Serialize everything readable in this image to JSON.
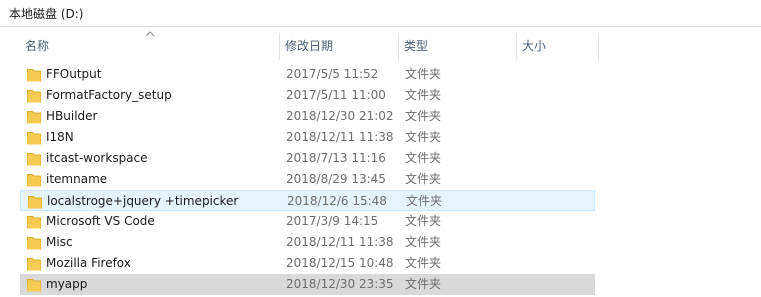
{
  "breadcrumb": "本地磁盘 (D:)",
  "columns": {
    "name": "名称",
    "date": "修改日期",
    "type": "类型",
    "size": "大小"
  },
  "colors": {
    "folder": "#f5cb51",
    "folder_dark": "#dcaa2c",
    "header_text": "#4c607a",
    "hover_bg": "#e5f3ff",
    "selected_bg": "#d9d9d9"
  },
  "rows": [
    {
      "name": "FFOutput",
      "date": "2017/5/5 11:52",
      "type": "文件夹",
      "icon": "folder-icon"
    },
    {
      "name": "FormatFactory_setup",
      "date": "2017/5/11 11:00",
      "type": "文件夹",
      "icon": "folder-icon"
    },
    {
      "name": "HBuilder",
      "date": "2018/12/30 21:02",
      "type": "文件夹",
      "icon": "folder-icon"
    },
    {
      "name": "I18N",
      "date": "2018/12/11 11:38",
      "type": "文件夹",
      "icon": "folder-icon"
    },
    {
      "name": "itcast-workspace",
      "date": "2018/7/13 11:16",
      "type": "文件夹",
      "icon": "folder-icon"
    },
    {
      "name": "itemname",
      "date": "2018/8/29 13:45",
      "type": "文件夹",
      "icon": "folder-icon"
    },
    {
      "name": "localstroge+jquery +timepicker",
      "date": "2018/12/6 15:48",
      "type": "文件夹",
      "icon": "folder-icon",
      "state": "hover"
    },
    {
      "name": "Microsoft VS Code",
      "date": "2017/3/9 14:15",
      "type": "文件夹",
      "icon": "folder-icon"
    },
    {
      "name": "Misc",
      "date": "2018/12/11 11:38",
      "type": "文件夹",
      "icon": "folder-icon"
    },
    {
      "name": "Mozilla Firefox",
      "date": "2018/12/15 10:48",
      "type": "文件夹",
      "icon": "folder-icon"
    },
    {
      "name": "myapp",
      "date": "2018/12/30 23:35",
      "type": "文件夹",
      "icon": "folder-icon",
      "state": "selected"
    }
  ]
}
